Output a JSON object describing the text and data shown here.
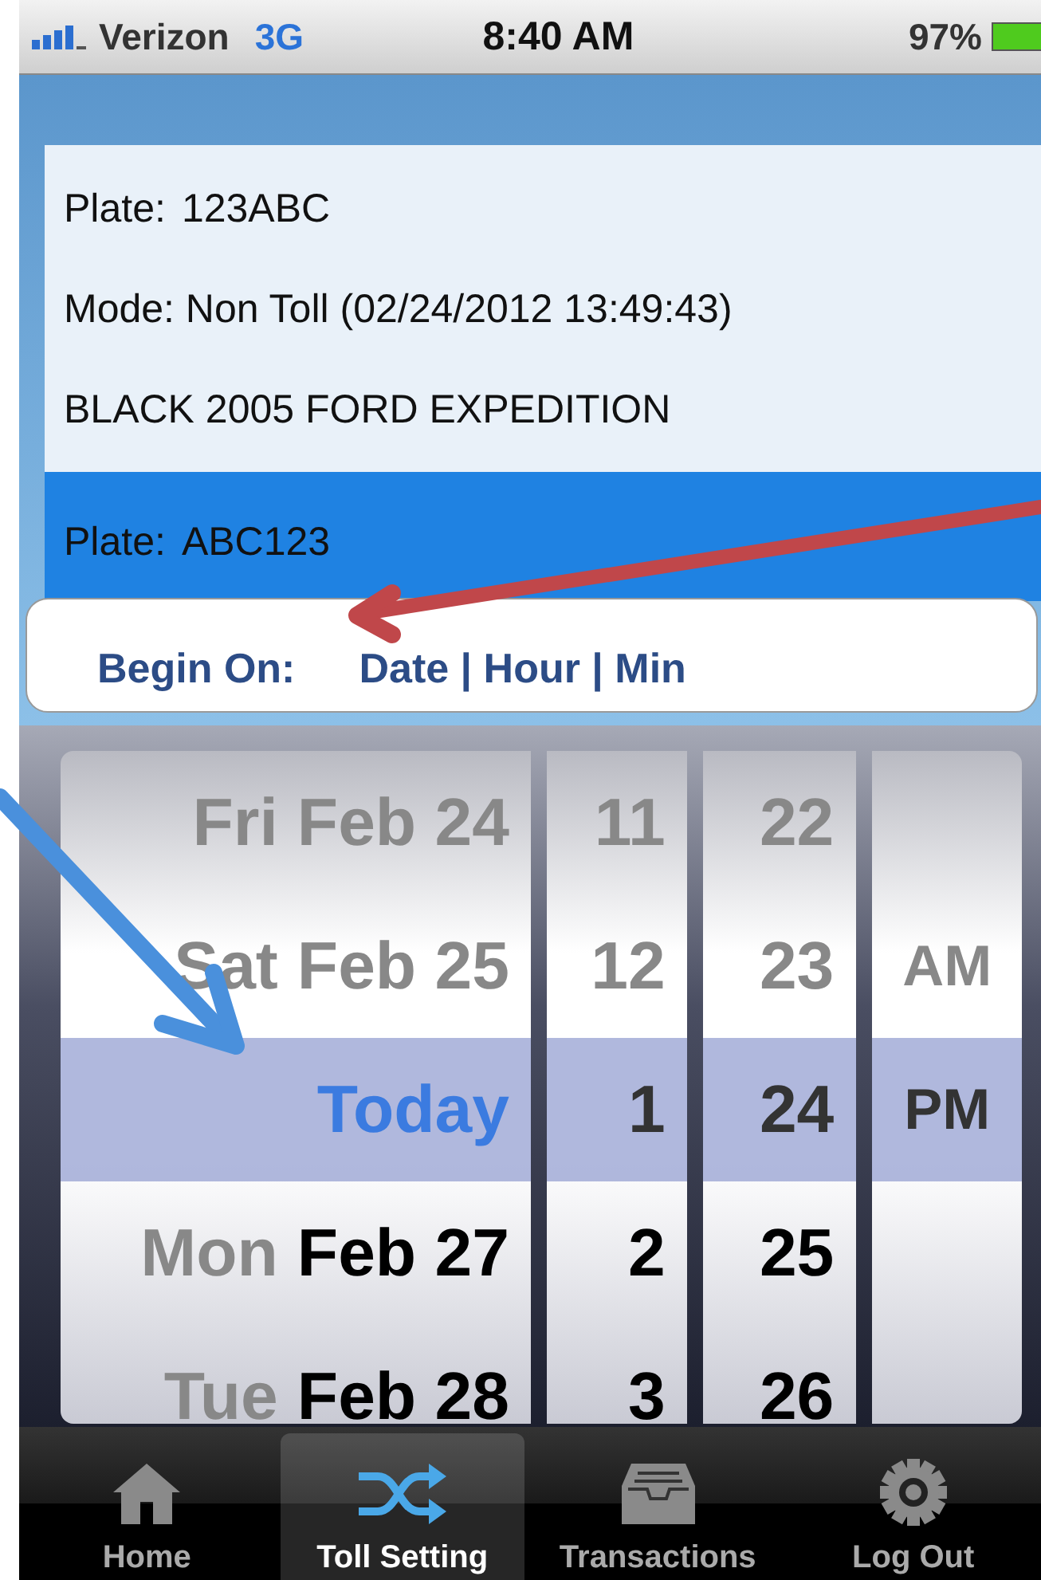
{
  "status_bar": {
    "carrier": "Verizon",
    "network": "3G",
    "time": "8:40 AM",
    "battery": "97%"
  },
  "vehicles": [
    {
      "plate_label": "Plate:",
      "plate": "123ABC",
      "mode": "Mode: Non Toll (02/24/2012 13:49:43)",
      "description": "BLACK 2005 FORD EXPEDITION",
      "selected": false
    },
    {
      "plate_label": "Plate:",
      "plate": "ABC123",
      "selected": true
    }
  ],
  "begin_on": {
    "label": "Begin On:",
    "fields": "Date | Hour | Min"
  },
  "picker": {
    "columns": [
      {
        "kind": "date",
        "items": [
          {
            "weekday": "Fri",
            "date": "Feb 24",
            "selected": false
          },
          {
            "weekday": "Sat",
            "date": "Feb 25",
            "selected": false
          },
          {
            "date": "Today",
            "selected": true
          },
          {
            "weekday": "Mon",
            "date": "Feb 27",
            "selected": false
          },
          {
            "weekday": "Tue",
            "date": "Feb 28",
            "selected": false
          }
        ]
      },
      {
        "kind": "hour",
        "items": [
          {
            "value": "11",
            "selected": false
          },
          {
            "value": "12",
            "selected": false
          },
          {
            "value": "1",
            "selected": true
          },
          {
            "value": "2",
            "selected": false
          },
          {
            "value": "3",
            "selected": false
          }
        ]
      },
      {
        "kind": "minute",
        "items": [
          {
            "value": "22",
            "selected": false
          },
          {
            "value": "23",
            "selected": false
          },
          {
            "value": "24",
            "selected": true
          },
          {
            "value": "25",
            "selected": false
          },
          {
            "value": "26",
            "selected": false
          }
        ]
      },
      {
        "kind": "ampm",
        "items": [
          {
            "selected": false
          },
          {
            "value": "AM",
            "selected": false
          },
          {
            "value": "PM",
            "selected": true
          },
          {
            "selected": false
          },
          {
            "selected": false
          }
        ]
      }
    ]
  },
  "tabs": [
    {
      "label": "Home",
      "selected": false
    },
    {
      "label": "Toll Setting",
      "selected": true
    },
    {
      "label": "Transactions",
      "selected": false
    },
    {
      "label": "Log Out",
      "selected": false
    }
  ]
}
